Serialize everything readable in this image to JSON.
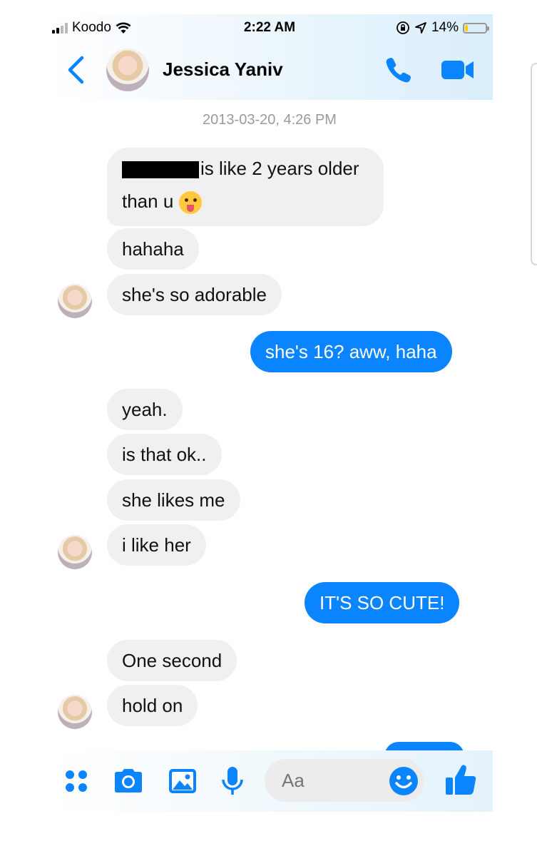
{
  "status_bar": {
    "carrier": "Koodo",
    "time": "2:22 AM",
    "battery_percent": "14%",
    "battery_level": 0.14
  },
  "header": {
    "contact_name": "Jessica Yaniv"
  },
  "conversation": {
    "timestamp": "2013-03-20, 4:26 PM",
    "messages": [
      {
        "direction": "in",
        "text_line1": "is like 2 years older",
        "text_line2": "than u"
      },
      {
        "direction": "in",
        "text": "hahaha"
      },
      {
        "direction": "in",
        "text": "she's so adorable"
      },
      {
        "direction": "out",
        "text": "she's 16? aww, haha"
      },
      {
        "direction": "in",
        "text": "yeah."
      },
      {
        "direction": "in",
        "text": "is that ok.."
      },
      {
        "direction": "in",
        "text": "she likes me"
      },
      {
        "direction": "in",
        "text": "i like her"
      },
      {
        "direction": "out",
        "text": "IT'S SO CUTE!"
      },
      {
        "direction": "in",
        "text": "One second"
      },
      {
        "direction": "in",
        "text": "hold on"
      }
    ]
  },
  "composer": {
    "placeholder": "Aa"
  },
  "colors": {
    "accent": "#0a84ff",
    "incoming_bubble": "#f0f0f0",
    "timestamp": "#9a9a9a"
  }
}
